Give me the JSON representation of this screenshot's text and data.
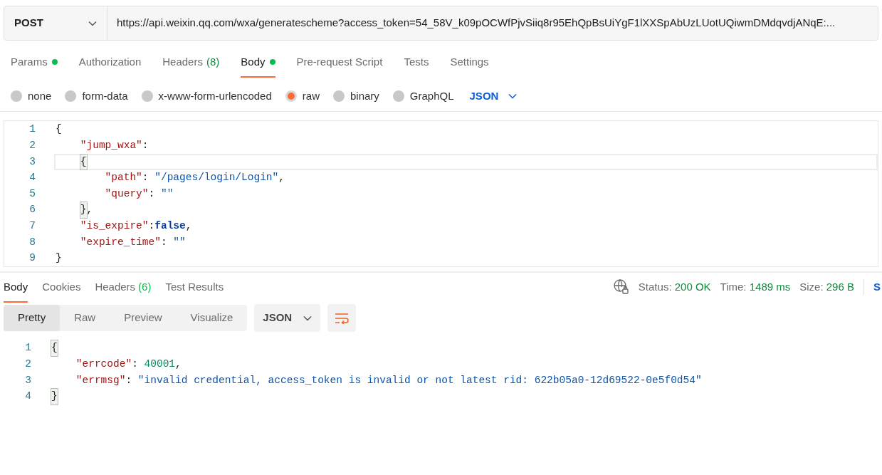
{
  "request": {
    "method": "POST",
    "url": "https://api.weixin.qq.com/wxa/generatescheme?access_token=54_58V_k09pOCWfPjvSiiq8r95EhQpBsUiYgF1lXXSpAbUzLUotUQiwmDMdqvdjANqE:..."
  },
  "request_tabs": [
    {
      "label": "Params",
      "dot": true,
      "selected": false
    },
    {
      "label": "Authorization",
      "dot": false,
      "selected": false
    },
    {
      "label": "Headers",
      "count": "(8)",
      "dot": false,
      "selected": false
    },
    {
      "label": "Body",
      "dot": true,
      "selected": true
    },
    {
      "label": "Pre-request Script",
      "dot": false,
      "selected": false
    },
    {
      "label": "Tests",
      "dot": false,
      "selected": false
    },
    {
      "label": "Settings",
      "dot": false,
      "selected": false
    }
  ],
  "body_types": [
    {
      "label": "none",
      "selected": false
    },
    {
      "label": "form-data",
      "selected": false
    },
    {
      "label": "x-www-form-urlencoded",
      "selected": false
    },
    {
      "label": "raw",
      "selected": true
    },
    {
      "label": "binary",
      "selected": false
    },
    {
      "label": "GraphQL",
      "selected": false
    }
  ],
  "body_format": "JSON",
  "request_body": [
    {
      "number": "1",
      "active": false,
      "bracket_match": false,
      "tokens": [
        {
          "kind": "brace",
          "text": "{"
        }
      ]
    },
    {
      "number": "2",
      "active": false,
      "tokens": [
        {
          "kind": "key",
          "text": "    \"jump_wxa\""
        },
        {
          "kind": "punct",
          "text": ":"
        }
      ]
    },
    {
      "number": "3",
      "active": true,
      "bracket_match": true,
      "tokens": [
        {
          "kind": "brace",
          "text": "    {"
        }
      ]
    },
    {
      "number": "4",
      "active": false,
      "tokens": [
        {
          "kind": "key",
          "text": "        \"path\""
        },
        {
          "kind": "punct",
          "text": ": "
        },
        {
          "kind": "str",
          "text": "\"/pages/login/Login\""
        },
        {
          "kind": "punct",
          "text": ","
        }
      ]
    },
    {
      "number": "5",
      "active": false,
      "tokens": [
        {
          "kind": "key",
          "text": "        \"query\""
        },
        {
          "kind": "punct",
          "text": ": "
        },
        {
          "kind": "str",
          "text": "\"\""
        }
      ]
    },
    {
      "number": "6",
      "active": false,
      "bracket_match": true,
      "tokens": [
        {
          "kind": "brace",
          "text": "    }"
        },
        {
          "kind": "punct",
          "text": ","
        }
      ]
    },
    {
      "number": "7",
      "active": false,
      "tokens": [
        {
          "kind": "key",
          "text": "    \"is_expire\""
        },
        {
          "kind": "punct",
          "text": ":"
        },
        {
          "kind": "kw",
          "text": "false"
        },
        {
          "kind": "punct",
          "text": ","
        }
      ]
    },
    {
      "number": "8",
      "active": false,
      "tokens": [
        {
          "kind": "key",
          "text": "    \"expire_time\""
        },
        {
          "kind": "punct",
          "text": ": "
        },
        {
          "kind": "str",
          "text": "\"\""
        }
      ]
    },
    {
      "number": "9",
      "active": false,
      "bracket_match": false,
      "tokens": [
        {
          "kind": "brace",
          "text": "}"
        }
      ]
    }
  ],
  "response_tabs": [
    {
      "label": "Body",
      "selected": true
    },
    {
      "label": "Cookies",
      "selected": false
    },
    {
      "label": "Headers",
      "count": "(6)",
      "selected": false
    },
    {
      "label": "Test Results",
      "selected": false
    }
  ],
  "response_meta": [
    {
      "label": "Status:",
      "value": "200 OK"
    },
    {
      "label": "Time:",
      "value": "1489 ms"
    },
    {
      "label": "Size:",
      "value": "296 B"
    }
  ],
  "save_link": "S",
  "view_modes": [
    {
      "label": "Pretty",
      "selected": true
    },
    {
      "label": "Raw",
      "selected": false
    },
    {
      "label": "Preview",
      "selected": false
    },
    {
      "label": "Visualize",
      "selected": false
    }
  ],
  "response_format": "JSON",
  "response_body": [
    {
      "number": "1",
      "active": false,
      "bracket_match": true,
      "tokens": [
        {
          "kind": "brace",
          "text": "{"
        }
      ]
    },
    {
      "number": "2",
      "active": false,
      "tokens": [
        {
          "kind": "key",
          "text": "    \"errcode\""
        },
        {
          "kind": "punct",
          "text": ": "
        },
        {
          "kind": "num",
          "text": "40001"
        },
        {
          "kind": "punct",
          "text": ","
        }
      ]
    },
    {
      "number": "3",
      "active": false,
      "tokens": [
        {
          "kind": "key",
          "text": "    \"errmsg\""
        },
        {
          "kind": "punct",
          "text": ": "
        },
        {
          "kind": "str",
          "text": "\"invalid credential, access_token is invalid or not latest rid: 622b05a0-12d69522-0e5f0d54\""
        }
      ]
    },
    {
      "number": "4",
      "active": false,
      "bracket_match": true,
      "tokens": [
        {
          "kind": "brace",
          "text": "}"
        }
      ]
    }
  ]
}
